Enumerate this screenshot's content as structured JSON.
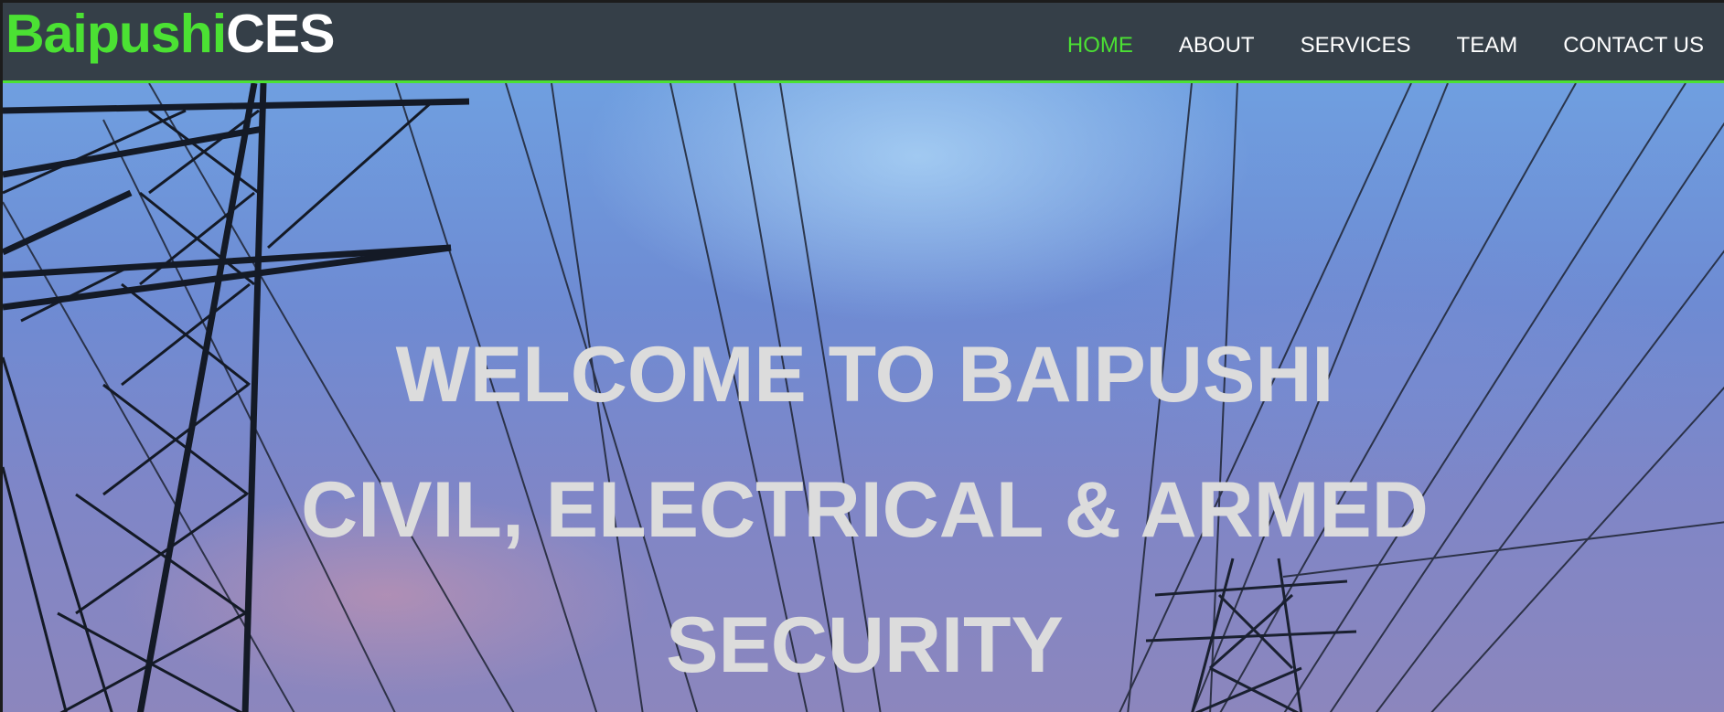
{
  "brand": {
    "part1": "Baipushi",
    "part2": "CES",
    "accent_color": "#4be133"
  },
  "nav": {
    "items": [
      {
        "label": "HOME",
        "active": true
      },
      {
        "label": "ABOUT",
        "active": false
      },
      {
        "label": "SERVICES",
        "active": false
      },
      {
        "label": "TEAM",
        "active": false
      },
      {
        "label": "CONTACT US",
        "active": false
      }
    ]
  },
  "hero": {
    "line1": "WELCOME TO BAIPUSHI",
    "line2": "CIVIL, ELECTRICAL & ARMED",
    "line3": "SECURITY",
    "background_image": "power-lines-pylon"
  }
}
